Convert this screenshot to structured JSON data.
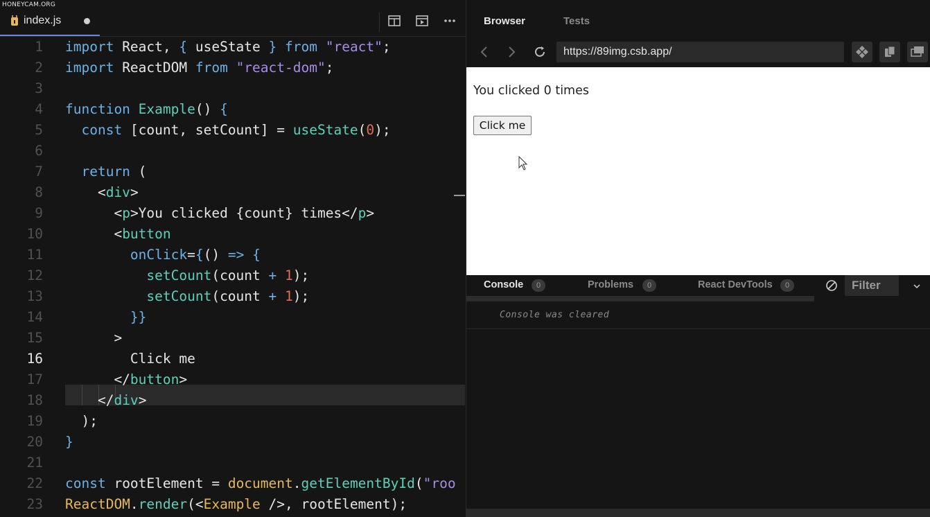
{
  "watermark": "HONEYCAM.ORG",
  "editor": {
    "file_tab": {
      "name": "index.js",
      "modified": true
    },
    "current_line": 16,
    "lines": [
      {
        "n": "1",
        "tokens": [
          [
            "k",
            "import "
          ],
          [
            "p",
            "React, "
          ],
          [
            "k",
            "{ "
          ],
          [
            "p",
            "useState "
          ],
          [
            "k",
            "} "
          ],
          [
            "k",
            "from "
          ],
          [
            "s",
            "\"react\""
          ],
          [
            "p",
            ";"
          ]
        ]
      },
      {
        "n": "2",
        "tokens": [
          [
            "k",
            "import "
          ],
          [
            "p",
            "ReactDOM "
          ],
          [
            "k",
            "from "
          ],
          [
            "s",
            "\"react-dom\""
          ],
          [
            "p",
            ";"
          ]
        ]
      },
      {
        "n": "3",
        "tokens": []
      },
      {
        "n": "4",
        "tokens": [
          [
            "k",
            "function "
          ],
          [
            "f",
            "Example"
          ],
          [
            "p",
            "() "
          ],
          [
            "k",
            "{"
          ]
        ]
      },
      {
        "n": "5",
        "tokens": [
          [
            "p",
            "  "
          ],
          [
            "k",
            "const "
          ],
          [
            "p",
            "[count, setCount] = "
          ],
          [
            "f",
            "useState"
          ],
          [
            "p",
            "("
          ],
          [
            "n",
            "0"
          ],
          [
            "p",
            ");"
          ]
        ]
      },
      {
        "n": "6",
        "tokens": []
      },
      {
        "n": "7",
        "tokens": [
          [
            "p",
            "  "
          ],
          [
            "k",
            "return "
          ],
          [
            "p",
            "("
          ]
        ]
      },
      {
        "n": "8",
        "tokens": [
          [
            "p",
            "    <"
          ],
          [
            "f",
            "div"
          ],
          [
            "p",
            ">"
          ]
        ]
      },
      {
        "n": "9",
        "tokens": [
          [
            "p",
            "      <"
          ],
          [
            "f",
            "p"
          ],
          [
            "p",
            ">You clicked {count} times</"
          ],
          [
            "f",
            "p"
          ],
          [
            "p",
            ">"
          ]
        ]
      },
      {
        "n": "10",
        "tokens": [
          [
            "p",
            "      <"
          ],
          [
            "f",
            "button"
          ]
        ]
      },
      {
        "n": "11",
        "tokens": [
          [
            "p",
            "        "
          ],
          [
            "k",
            "onClick"
          ],
          [
            "p",
            "="
          ],
          [
            "k",
            "{"
          ],
          [
            "p",
            "() "
          ],
          [
            "k",
            "=> {"
          ]
        ]
      },
      {
        "n": "12",
        "tokens": [
          [
            "p",
            "          "
          ],
          [
            "f",
            "setCount"
          ],
          [
            "p",
            "(count "
          ],
          [
            "k",
            "+ "
          ],
          [
            "n",
            "1"
          ],
          [
            "p",
            ");"
          ]
        ]
      },
      {
        "n": "13",
        "tokens": [
          [
            "p",
            "          "
          ],
          [
            "f",
            "setCount"
          ],
          [
            "p",
            "(count "
          ],
          [
            "k",
            "+ "
          ],
          [
            "n",
            "1"
          ],
          [
            "p",
            ");"
          ]
        ]
      },
      {
        "n": "14",
        "tokens": [
          [
            "p",
            "        "
          ],
          [
            "k",
            "}}"
          ]
        ]
      },
      {
        "n": "15",
        "tokens": [
          [
            "p",
            "      >"
          ]
        ]
      },
      {
        "n": "16",
        "tokens": [
          [
            "p",
            "        Click me"
          ]
        ]
      },
      {
        "n": "17",
        "tokens": [
          [
            "p",
            "      </"
          ],
          [
            "f",
            "button"
          ],
          [
            "p",
            ">"
          ]
        ]
      },
      {
        "n": "18",
        "tokens": [
          [
            "p",
            "    </"
          ],
          [
            "f",
            "div"
          ],
          [
            "p",
            ">"
          ]
        ]
      },
      {
        "n": "19",
        "tokens": [
          [
            "p",
            "  );"
          ]
        ]
      },
      {
        "n": "20",
        "tokens": [
          [
            "k",
            "}"
          ]
        ]
      },
      {
        "n": "21",
        "tokens": []
      },
      {
        "n": "22",
        "tokens": [
          [
            "k",
            "const "
          ],
          [
            "p",
            "rootElement = "
          ],
          [
            "y",
            "document"
          ],
          [
            "p",
            "."
          ],
          [
            "f",
            "getElementById"
          ],
          [
            "p",
            "("
          ],
          [
            "s",
            "\"roo"
          ]
        ]
      },
      {
        "n": "23",
        "tokens": [
          [
            "y",
            "ReactDOM"
          ],
          [
            "p",
            "."
          ],
          [
            "f",
            "render"
          ],
          [
            "p",
            "(<"
          ],
          [
            "y",
            "Example "
          ],
          [
            "p",
            "/>, rootElement);"
          ]
        ]
      }
    ]
  },
  "browser": {
    "tabs": [
      "Browser",
      "Tests"
    ],
    "active_tab": "Browser",
    "url": "https://89img.csb.app/",
    "preview": {
      "paragraph": "You clicked 0 times",
      "button_label": "Click me"
    }
  },
  "console": {
    "tabs": [
      {
        "label": "Console",
        "count": "0",
        "active": true
      },
      {
        "label": "Problems",
        "count": "0",
        "active": false
      },
      {
        "label": "React DevTools",
        "count": "0",
        "active": false
      }
    ],
    "filter_placeholder": "Filter",
    "message": "Console was cleared"
  },
  "colors": {
    "keyword": "#6cb2e6",
    "string": "#a58ee6",
    "function": "#5fd0b8",
    "number": "#e06c5a",
    "global": "#e6b85a",
    "accent": "#6a86d8"
  }
}
